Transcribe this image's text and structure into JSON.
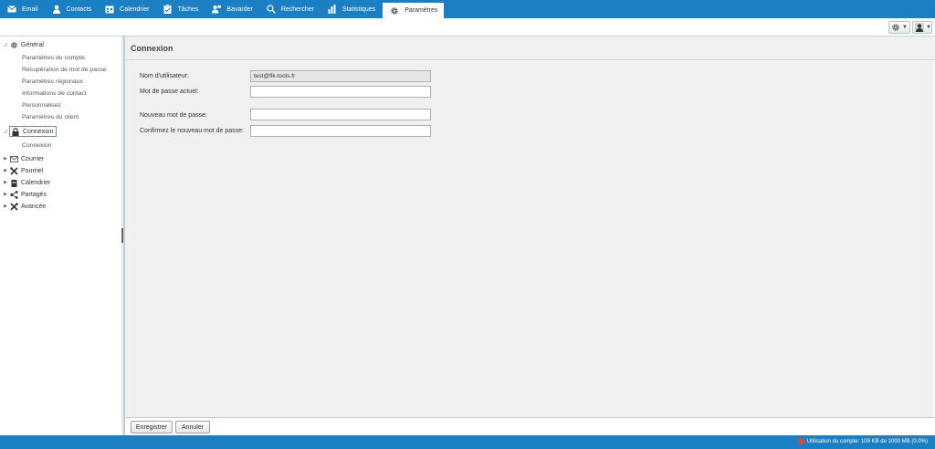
{
  "nav": {
    "tabs": [
      {
        "label": "Email",
        "icon": "envelope-icon"
      },
      {
        "label": "Contacts",
        "icon": "person-icon"
      },
      {
        "label": "Calendrier",
        "icon": "calendar-icon"
      },
      {
        "label": "Tâches",
        "icon": "clipboard-icon"
      },
      {
        "label": "Bavarder",
        "icon": "chat-user-icon"
      },
      {
        "label": "Rechercher",
        "icon": "search-icon"
      },
      {
        "label": "Statistiques",
        "icon": "bar-chart-icon"
      },
      {
        "label": "Paramètres",
        "icon": "gear-icon",
        "active": true
      }
    ]
  },
  "sidebar": {
    "general": {
      "label": "Général",
      "items": [
        "Paramètres du compte.",
        "Récupération de mot de passe",
        "Paramètres régionaux",
        "Informations de contact",
        "Personnalisez",
        "Paramètres du client"
      ]
    },
    "connexion": {
      "label": "Connexion",
      "items": [
        "Connexion"
      ]
    },
    "others": [
      {
        "label": "Courrier",
        "icon": "envelope-outline-icon"
      },
      {
        "label": "Pourriel",
        "icon": "tools-icon"
      },
      {
        "label": "Calendrier",
        "icon": "calendar-small-icon"
      },
      {
        "label": "Partagés",
        "icon": "share-icon"
      },
      {
        "label": "Avancée",
        "icon": "wrench-icon"
      }
    ]
  },
  "main": {
    "title": "Connexion",
    "fields": {
      "username_label": "Nom d'utilisateur:",
      "username_value": "test@flk-tools.fr",
      "current_password_label": "Mot de passe actuel:",
      "current_password_value": "",
      "new_password_label": "Nouveau mot de passe:",
      "new_password_value": "",
      "confirm_password_label": "Confirmez le nouveau mot de passe:",
      "confirm_password_value": ""
    }
  },
  "buttons": {
    "save": "Enregistrer",
    "cancel": "Annuler"
  },
  "status": {
    "usage": "Utilisation du compte: 109 KB de 1000 MB (0.0%)"
  },
  "colors": {
    "accent": "#1a7fc3",
    "quota_dot": "#e0462f"
  }
}
